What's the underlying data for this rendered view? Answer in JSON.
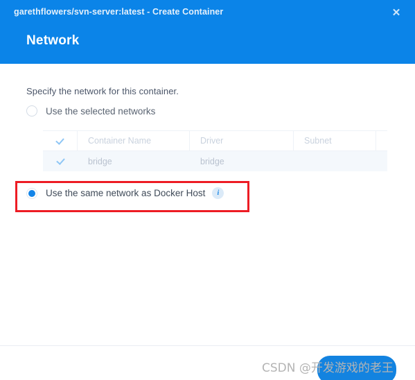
{
  "window": {
    "title": "garethflowers/svn-server:latest - Create Container",
    "close_label": "✕",
    "step_title": "Network"
  },
  "body": {
    "instruction": "Specify the network for this container.",
    "options": [
      {
        "id": "use-selected-networks",
        "label": "Use the selected networks",
        "selected": false,
        "has_info": false
      },
      {
        "id": "use-docker-host-network",
        "label": "Use the same network as Docker Host",
        "selected": true,
        "has_info": true,
        "info_glyph": "i"
      }
    ],
    "table": {
      "columns": [
        "",
        "Container Name",
        "Driver",
        "Subnet",
        ""
      ],
      "rows": [
        {
          "checked": true,
          "container_name": "bridge",
          "driver": "bridge",
          "subnet": ""
        }
      ]
    }
  },
  "footer": {
    "primary_button": ""
  },
  "watermark": {
    "text": "CSDN @开发游戏的老王"
  },
  "colors": {
    "header_blue": "#0b84e8",
    "accent_blue": "#1383e0",
    "annotation_red": "#ed1c24",
    "row_background": "#f4f8fc",
    "muted_text": "#c9d2de"
  }
}
